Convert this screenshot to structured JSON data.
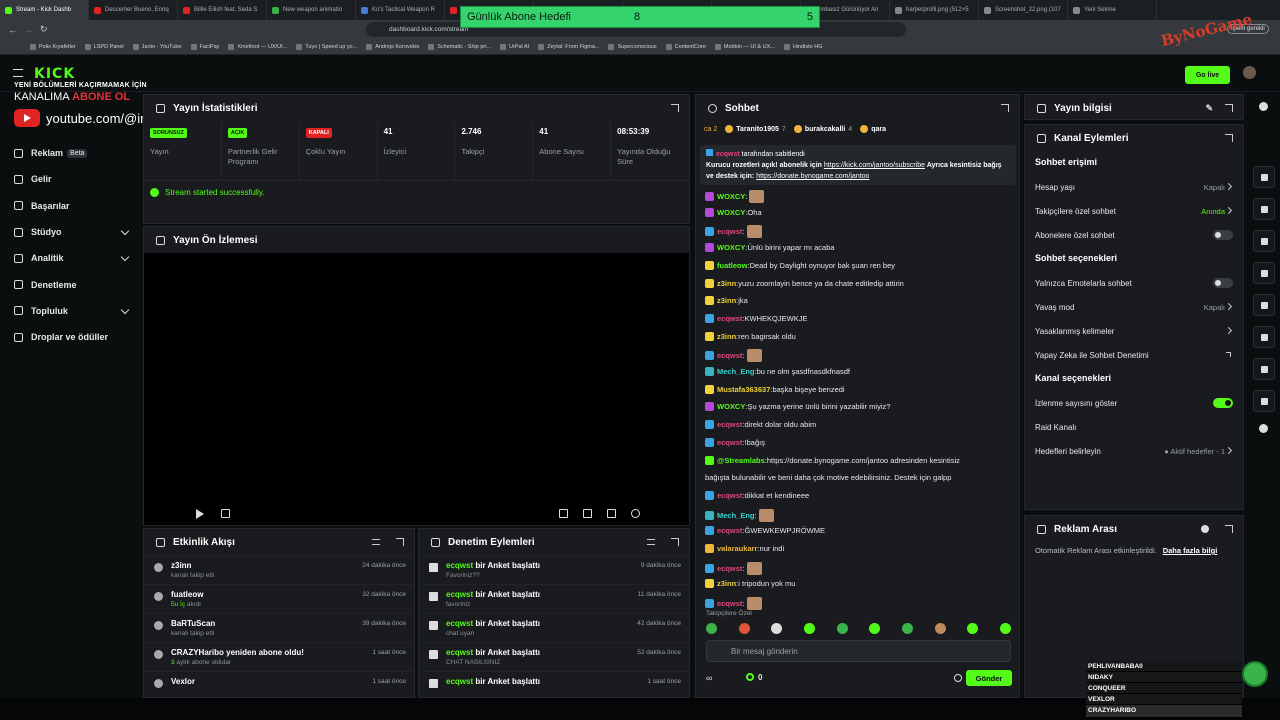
{
  "browser": {
    "tabs": [
      {
        "label": "Stream - Kick Dashb",
        "color": "#53fc18",
        "active": true
      },
      {
        "label": "Descemer Bueno, Enriq",
        "color": "#e02424"
      },
      {
        "label": "Billie Eilish feat. Seda S",
        "color": "#e02424"
      },
      {
        "label": "New weapon animatio",
        "color": "#3ab34a"
      },
      {
        "label": "Ko's Tactical Weapon R",
        "color": "#4a7bd8"
      },
      {
        "label": "",
        "color": "#e02424"
      },
      {
        "label": "",
        "color": "#e02424"
      },
      {
        "label": "",
        "color": "#e02424"
      },
      {
        "label": "",
        "color": "#e02424"
      },
      {
        "label": "umbasız Görünüyor An",
        "color": "#888"
      },
      {
        "label": "harperprofil.png (512×5",
        "color": "#888"
      },
      {
        "label": "Screenshot_22.png (107",
        "color": "#888"
      },
      {
        "label": "Yeni Sekme",
        "color": "#888"
      }
    ],
    "url": "dashboard.kick.com/stream",
    "update_label": "İşlem gerekli",
    "bookmarks": [
      "Polis Kıyafetler",
      "LSPD Panel",
      "Janto - YouTube",
      "FaciPay",
      "Xmethod — UX/UI...",
      "Tuyo | Speed up yo...",
      "Andrejs Korovskis",
      "Schematic - Ship pri...",
      "UrPal AI",
      "Zeytal: From Figma...",
      "Superconscious",
      "ContentCore",
      "Mobbin — UI & UX...",
      "Hindisto HG"
    ]
  },
  "overlay": {
    "goal_title": "Günlük Abone Hedefi",
    "goal_current": "8",
    "goal_target": "5",
    "watermark": "ByNoGame",
    "promo_line1": "YENİ BÖLÜMLERİ KAÇIRMAMAK İÇİN",
    "promo_line2a": "KANALIMA ",
    "promo_line2b": "ABONE OL",
    "promo_url": "youtube.com/@imjanto",
    "scoreboard": [
      "PEHLIVANBABA0",
      "NIDAKY",
      "CONQUEER",
      "VEXLOR",
      "CRAZYHARIBO"
    ]
  },
  "header": {
    "logo": "KICK",
    "golive": "Go live"
  },
  "sidebar": {
    "items": [
      {
        "label": "Reklam",
        "badge": "Beta"
      },
      {
        "label": "Gelir"
      },
      {
        "label": "Başarılar"
      },
      {
        "label": "Stüdyo",
        "expand": true
      },
      {
        "label": "Analitik",
        "expand": true
      },
      {
        "label": "Denetleme"
      },
      {
        "label": "Topluluk",
        "expand": true
      },
      {
        "label": "Droplar ve ödüller"
      }
    ]
  },
  "stats": {
    "title": "Yayın İstatistikleri",
    "items": [
      {
        "value": "SORUNSUZ",
        "badge": true,
        "badge_color": "#53fc18",
        "label": "Yayın"
      },
      {
        "value": "AÇIK",
        "badge": true,
        "badge_color": "#53fc18",
        "label": "Partnerlik Gelir Programı"
      },
      {
        "value": "KAPALI",
        "badge": true,
        "badge_color": "#e02424",
        "label": "Çoklu Yayın"
      },
      {
        "value": "41",
        "label": "İzleyici"
      },
      {
        "value": "2.746",
        "label": "Takipçi"
      },
      {
        "value": "41",
        "label": "Abone Sayısı"
      },
      {
        "value": "08:53:39",
        "label": "Yayında Olduğu Süre"
      }
    ],
    "status": "Stream started successfully."
  },
  "preview": {
    "title": "Yayın Ön İzlemesi"
  },
  "activity": {
    "title": "Etkinlik Akışı",
    "items": [
      {
        "name": "z3inn",
        "sub": "kanalı takip etti",
        "time": "24 dakika önce"
      },
      {
        "name": "fuatleow",
        "sub_green": "5u İç",
        "sub": " akıdı",
        "time": "32 dakika önce"
      },
      {
        "name": "BaRTuScan",
        "sub": "kanalı takip etti",
        "time": "39 dakika önce"
      },
      {
        "name": "CRAZYHaribo yeniden abone oldu!",
        "sub_green": "3",
        "sub": " aylık abone oldular",
        "time": "1 saat önce"
      },
      {
        "name": "Vexlor",
        "sub": "",
        "time": "1 saat önce"
      }
    ]
  },
  "modlog": {
    "title": "Denetim Eylemleri",
    "items": [
      {
        "user": "ecqwst",
        "action": " bir Anket başlattı",
        "sub": "Favoriniz??",
        "time": "9 dakika önce"
      },
      {
        "user": "ecqwst",
        "action": " bir Anket başlattı",
        "sub": "favoriniz",
        "time": "11 dakika önce"
      },
      {
        "user": "ecqwst",
        "action": " bir Anket başlattı",
        "sub": "chat uyan",
        "time": "42 dakika önce"
      },
      {
        "user": "ecqwst",
        "action": " bir Anket başlattı",
        "sub": "CHAT NASILSINIZ",
        "time": "52 dakika önce"
      },
      {
        "user": "ecqwst",
        "action": " bir Anket başlattı",
        "sub": "",
        "time": "1 saat önce"
      }
    ]
  },
  "chat": {
    "title": "Sohbet",
    "top_rank": "ca 2",
    "gifters": [
      {
        "name": "Taranito1905",
        "count": "7"
      },
      {
        "name": "burakcakalli",
        "count": "4"
      },
      {
        "name": "qara",
        "count": ""
      }
    ],
    "pinned_by": "ecqwst",
    "pinned_suffix": " tarafından sabitlendi",
    "pinned_text1": "Kurucu rozetleri açık! abonelik için ",
    "pinned_link1": "https://kick.com/jantoo/subscribe",
    "pinned_text2": " Ayrıca kesintisiz bağış ve destek için: ",
    "pinned_link2": "https://donate.bynogame.com/jantoo",
    "messages": [
      {
        "badge": "#b14ad8",
        "user": "WOXCY",
        "color": "#53fc18",
        "text": "",
        "emote": true
      },
      {
        "badge": "#b14ad8",
        "user": "WOXCY",
        "color": "#53fc18",
        "text": "Oha"
      },
      {
        "badge": "#3aa5e0",
        "user": "ecqwst",
        "color": "#e2457c",
        "text": "",
        "emote": true
      },
      {
        "badge": "#b14ad8",
        "user": "WOXCY",
        "color": "#53fc18",
        "text": "Ünlü birini yapar mı acaba"
      },
      {
        "badge": "#f0d23a",
        "user": "fuatleow",
        "color": "#53fc18",
        "text": "Dead by Daylight oynuyor bak şuan ren bey"
      },
      {
        "badge": "#f0d23a",
        "user": "z3inn",
        "color": "#f0d23a",
        "text": "yuzu zoomlayin bence ya da chate editledip attirin"
      },
      {
        "badge": "#f0d23a",
        "user": "z3inn",
        "color": "#f0d23a",
        "text": "jka"
      },
      {
        "badge": "#3aa5e0",
        "user": "ecqwst",
        "color": "#e2457c",
        "text": "KWHEKQJEWKJE"
      },
      {
        "badge": "#f0d23a",
        "user": "z3inn",
        "color": "#f0d23a",
        "text": "ren bagirsak oldu"
      },
      {
        "badge": "#3aa5e0",
        "user": "ecqwst",
        "color": "#e2457c",
        "text": "",
        "emote": true
      },
      {
        "badge": "#3ab3c0",
        "user": "Mech_Eng",
        "color": "#3ad0d0",
        "text": "bu ne olm şasdfnasdkfnasdf"
      },
      {
        "badge": "#f0d23a",
        "user": "Mustafa363637",
        "color": "#f0d23a",
        "text": "başka bişeye benzedi"
      },
      {
        "badge": "#b14ad8",
        "user": "WOXCY",
        "color": "#53fc18",
        "text": "Şu yazma yerine ünlü birini yazabilir miyiz?"
      },
      {
        "badge": "#3aa5e0",
        "user": "ecqwst",
        "color": "#e2457c",
        "text": "direkt dolar oldu abim"
      },
      {
        "badge": "#3aa5e0",
        "user": "ecqwst",
        "color": "#e2457c",
        "text": "!bağış"
      },
      {
        "badge": "#53fc18",
        "user": "@Streamlabs",
        "color": "#53fc18",
        "text": "https://donate.bynogame.com/jantoo adresinden kesintisiz",
        "text2": "bağışta bulunabilir ve beni daha çok motive edebilirsiniz. Destek için galpp"
      },
      {
        "badge": "#3aa5e0",
        "user": "ecqwst",
        "color": "#e2457c",
        "text": "dikkat et kendineee"
      },
      {
        "badge": "#3ab3c0",
        "user": "Mech_Eng",
        "color": "#3ad0d0",
        "text": "",
        "emote": true
      },
      {
        "badge": "#3aa5e0",
        "user": "ecqwst",
        "color": "#e2457c",
        "text": "ĞWEWKEWPJRÖWME"
      },
      {
        "badge": "#f0b53a",
        "user": "valaraukarr",
        "color": "#f0b53a",
        "text": "nur indi"
      },
      {
        "badge": "#3aa5e0",
        "user": "ecqwst",
        "color": "#e2457c",
        "text": "",
        "emote": true
      },
      {
        "badge": "#f0d23a",
        "user": "z3inn",
        "color": "#f0d23a",
        "text": "i tripodun yok mu"
      },
      {
        "badge": "#3aa5e0",
        "user": "ecqwst",
        "color": "#e2457c",
        "text": "",
        "emote": true
      }
    ],
    "followers_only": "Takipçilere Özel",
    "input_placeholder": "Bir mesaj gönderin",
    "points": "0",
    "send": "Gönder"
  },
  "stream_info": {
    "title": "Yayın bilgisi"
  },
  "channel": {
    "title": "Kanal Eylemleri",
    "sections": [
      {
        "title": "Sohbet erişimi",
        "rows": [
          {
            "label": "Hesap yaşı",
            "value": "Kapalı",
            "kind": "arrow"
          },
          {
            "label": "Takipçilere özel sohbet",
            "value": "Anında",
            "green": true,
            "kind": "arrow"
          },
          {
            "label": "Abonelere özel sohbet",
            "kind": "toggle",
            "on": false
          }
        ]
      },
      {
        "title": "Sohbet seçenekleri",
        "rows": [
          {
            "label": "Yalnızca Emotelarla sohbet",
            "kind": "toggle",
            "on": false
          },
          {
            "label": "Yavaş mod",
            "value": "Kapalı",
            "kind": "arrow"
          },
          {
            "label": "Yasaklanmış kelimeler",
            "kind": "arrow"
          },
          {
            "label": "Yapay Zeka ile Sohbet Denetimi",
            "kind": "ext"
          }
        ]
      },
      {
        "title": "Kanal seçenekleri",
        "rows": [
          {
            "label": "İzlenme sayısını göster",
            "kind": "toggle",
            "on": true
          },
          {
            "label": "Raid Kanalı",
            "kind": "none"
          },
          {
            "label": "Hedefleri belirleyin",
            "value": "● Aktif hedefler - 1",
            "green_dot": true,
            "kind": "arrow"
          }
        ]
      }
    ]
  },
  "ads": {
    "title": "Reklam Arası",
    "text": "Otomatik Reklam Arası etkinleştirildi.",
    "link": "Daha fazla bilgi"
  }
}
